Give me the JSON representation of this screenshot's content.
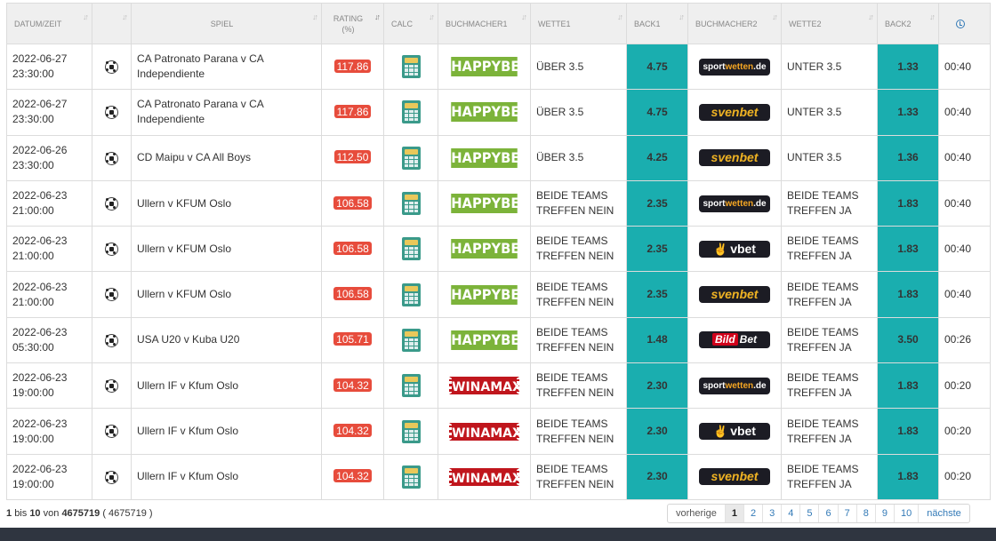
{
  "columns": {
    "datum": "DATUM/ZEIT",
    "sport": "",
    "spiel": "SPIEL",
    "rating": "RATING",
    "rating_unit": "(%)",
    "calc": "CALC",
    "buchmacher1": "BUCHMACHER1",
    "wette1": "WETTE1",
    "back1": "BACK1",
    "buchmacher2": "BUCHMACHER2",
    "wette2": "WETTE2",
    "back2": "BACK2",
    "time_icon": "clock-icon"
  },
  "rows": [
    {
      "date": "2022-06-27",
      "time": "23:30:00",
      "spiel": "CA Patronato Parana v CA Independiente",
      "rating": "117.86",
      "bm1": "HAPPYBET",
      "wette1": "ÜBER 3.5",
      "back1": "4.75",
      "bm2": "sportwetten",
      "wette2": "UNTER 3.5",
      "back2": "1.33",
      "t": "00:40"
    },
    {
      "date": "2022-06-27",
      "time": "23:30:00",
      "spiel": "CA Patronato Parana v CA Independiente",
      "rating": "117.86",
      "bm1": "HAPPYBET",
      "wette1": "ÜBER 3.5",
      "back1": "4.75",
      "bm2": "svenbet",
      "wette2": "UNTER 3.5",
      "back2": "1.33",
      "t": "00:40"
    },
    {
      "date": "2022-06-26",
      "time": "23:30:00",
      "spiel": "CD Maipu v CA All Boys",
      "rating": "112.50",
      "bm1": "HAPPYBET",
      "wette1": "ÜBER 3.5",
      "back1": "4.25",
      "bm2": "svenbet",
      "wette2": "UNTER 3.5",
      "back2": "1.36",
      "t": "00:40"
    },
    {
      "date": "2022-06-23",
      "time": "21:00:00",
      "spiel": "Ullern v KFUM Oslo",
      "rating": "106.58",
      "bm1": "HAPPYBET",
      "wette1": "BEIDE TEAMS TREFFEN NEIN",
      "back1": "2.35",
      "bm2": "sportwetten",
      "wette2": "BEIDE TEAMS TREFFEN JA",
      "back2": "1.83",
      "t": "00:40"
    },
    {
      "date": "2022-06-23",
      "time": "21:00:00",
      "spiel": "Ullern v KFUM Oslo",
      "rating": "106.58",
      "bm1": "HAPPYBET",
      "wette1": "BEIDE TEAMS TREFFEN NEIN",
      "back1": "2.35",
      "bm2": "vbet",
      "wette2": "BEIDE TEAMS TREFFEN JA",
      "back2": "1.83",
      "t": "00:40"
    },
    {
      "date": "2022-06-23",
      "time": "21:00:00",
      "spiel": "Ullern v KFUM Oslo",
      "rating": "106.58",
      "bm1": "HAPPYBET",
      "wette1": "BEIDE TEAMS TREFFEN NEIN",
      "back1": "2.35",
      "bm2": "svenbet",
      "wette2": "BEIDE TEAMS TREFFEN JA",
      "back2": "1.83",
      "t": "00:40"
    },
    {
      "date": "2022-06-23",
      "time": "05:30:00",
      "spiel": "USA U20 v Kuba U20",
      "rating": "105.71",
      "bm1": "HAPPYBET",
      "wette1": "BEIDE TEAMS TREFFEN NEIN",
      "back1": "1.48",
      "bm2": "bildbet",
      "wette2": "BEIDE TEAMS TREFFEN JA",
      "back2": "3.50",
      "t": "00:26"
    },
    {
      "date": "2022-06-23",
      "time": "19:00:00",
      "spiel": "Ullern IF v Kfum Oslo",
      "rating": "104.32",
      "bm1": "WINAMAX",
      "wette1": "BEIDE TEAMS TREFFEN NEIN",
      "back1": "2.30",
      "bm2": "sportwetten",
      "wette2": "BEIDE TEAMS TREFFEN JA",
      "back2": "1.83",
      "t": "00:20"
    },
    {
      "date": "2022-06-23",
      "time": "19:00:00",
      "spiel": "Ullern IF v Kfum Oslo",
      "rating": "104.32",
      "bm1": "WINAMAX",
      "wette1": "BEIDE TEAMS TREFFEN NEIN",
      "back1": "2.30",
      "bm2": "vbet",
      "wette2": "BEIDE TEAMS TREFFEN JA",
      "back2": "1.83",
      "t": "00:20"
    },
    {
      "date": "2022-06-23",
      "time": "19:00:00",
      "spiel": "Ullern IF v Kfum Oslo",
      "rating": "104.32",
      "bm1": "WINAMAX",
      "wette1": "BEIDE TEAMS TREFFEN NEIN",
      "back1": "2.30",
      "bm2": "svenbet",
      "wette2": "BEIDE TEAMS TREFFEN JA",
      "back2": "1.83",
      "t": "00:20"
    }
  ],
  "logos": {
    "happybet": "HAPPYBET",
    "winamax": "WINAMAX",
    "sportwetten_a": "sport",
    "sportwetten_b": "wetten",
    "sportwetten_c": ".de",
    "svenbet": "svenbet",
    "vbet": "vbet",
    "bildbet_a": "Bild",
    "bildbet_b": "Bet"
  },
  "footer": {
    "from": "1",
    "bis": "bis",
    "to": "10",
    "von": "von",
    "total": "4675719",
    "total_paren": "( 4675719 )"
  },
  "pagination": {
    "prev": "vorherige",
    "pages": [
      "1",
      "2",
      "3",
      "4",
      "5",
      "6",
      "7",
      "8",
      "9",
      "10"
    ],
    "current": "1",
    "next": "nächste"
  },
  "colors": {
    "back_cell": "#1aaeaf",
    "rating_badge": "#e74c3c",
    "happybet": "#7cb33a",
    "winamax": "#c0161d",
    "dark_logo": "#1c1c24"
  }
}
